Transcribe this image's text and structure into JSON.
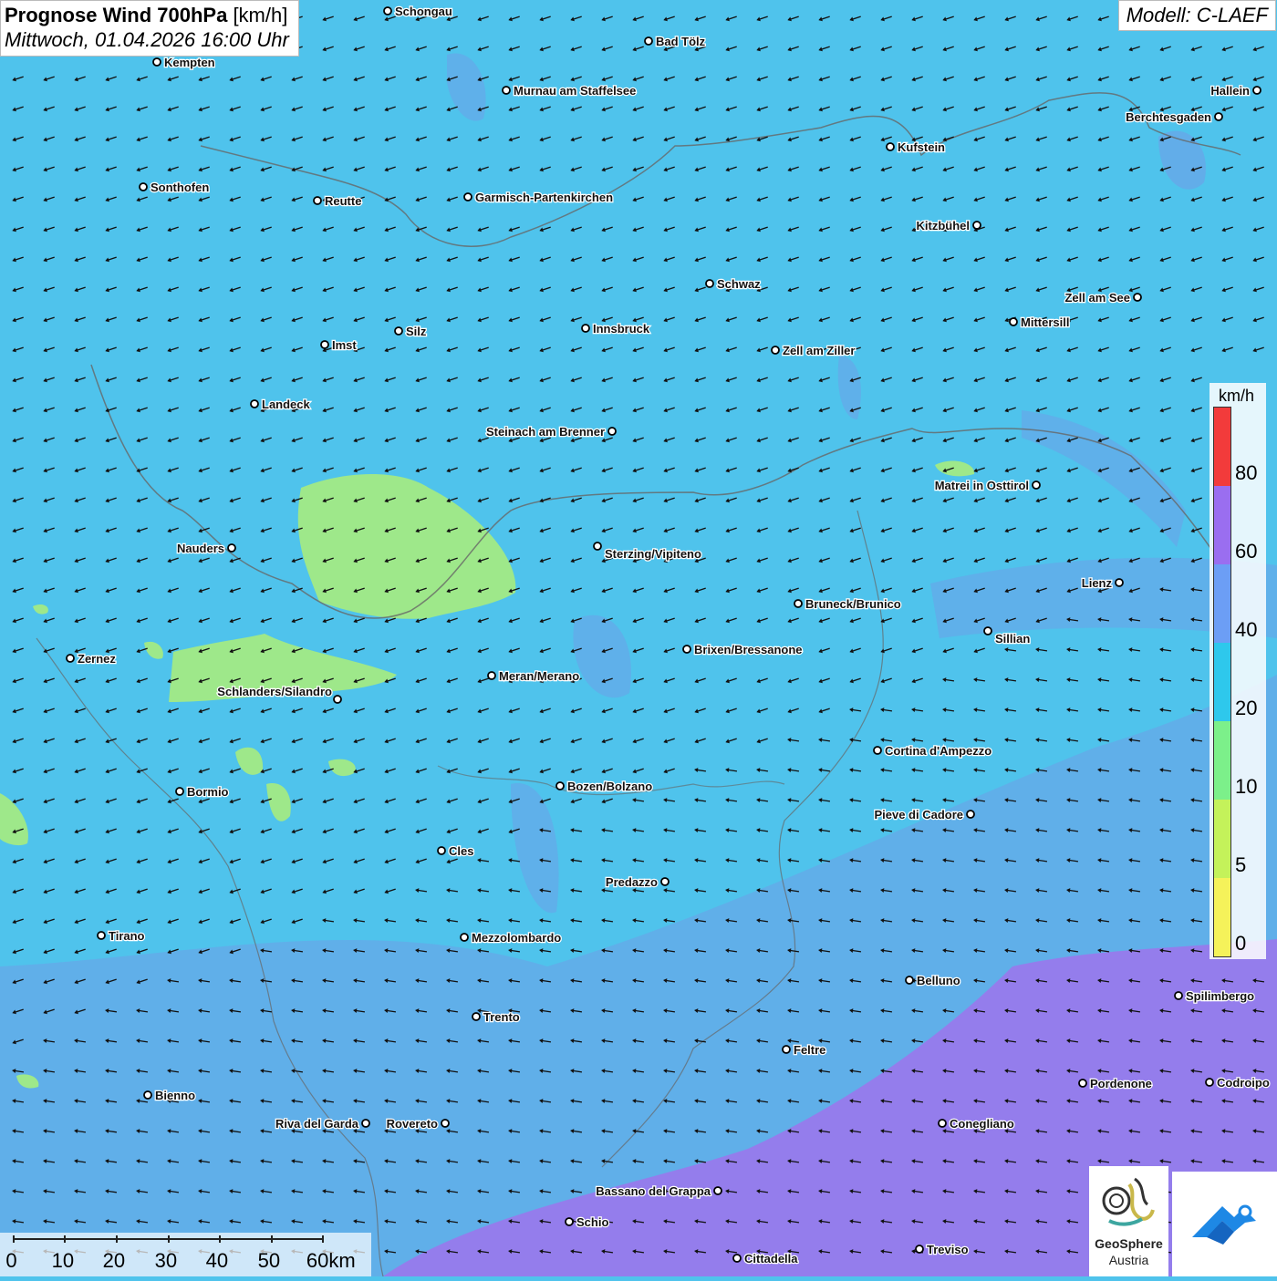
{
  "header": {
    "title": "Prognose Wind 700hPa",
    "title_unit": "[km/h]",
    "datetime": "Mittwoch, 01.04.2026 16:00 Uhr",
    "model": "Modell: C-LAEF"
  },
  "legend": {
    "unit": "km/h",
    "labels": [
      "80",
      "60",
      "40",
      "20",
      "10",
      "5",
      "0"
    ],
    "colors": [
      "#f23b3b",
      "#9a6ef0",
      "#6c9ef5",
      "#2ec8ec",
      "#7cf08a",
      "#c4f25a",
      "#f5f25a"
    ]
  },
  "scale": {
    "labels": [
      "0",
      "10",
      "20",
      "30",
      "40",
      "50",
      "60km"
    ]
  },
  "cities": [
    {
      "name": "Schongau"
    },
    {
      "name": "Bad Tölz"
    },
    {
      "name": "Kempten"
    },
    {
      "name": "Murnau am Staffelsee"
    },
    {
      "name": "Hallein"
    },
    {
      "name": "Berchtesgaden"
    },
    {
      "name": "Kufstein"
    },
    {
      "name": "Sonthofen"
    },
    {
      "name": "Reutte"
    },
    {
      "name": "Garmisch-Partenkirchen"
    },
    {
      "name": "Kitzbühel"
    },
    {
      "name": "Schwaz"
    },
    {
      "name": "Zell am See"
    },
    {
      "name": "Mittersill"
    },
    {
      "name": "Silz"
    },
    {
      "name": "Innsbruck"
    },
    {
      "name": "Imst"
    },
    {
      "name": "Zell am Ziller"
    },
    {
      "name": "Landeck"
    },
    {
      "name": "Steinach am Brenner"
    },
    {
      "name": "Matrei in Osttirol"
    },
    {
      "name": "Nauders"
    },
    {
      "name": "Sterzing/Vipiteno"
    },
    {
      "name": "Lienz"
    },
    {
      "name": "Bruneck/Brunico"
    },
    {
      "name": "Sillian"
    },
    {
      "name": "Zernez"
    },
    {
      "name": "Brixen/Bressanone"
    },
    {
      "name": "Meran/Merano"
    },
    {
      "name": "Schlanders/Silandro"
    },
    {
      "name": "Cortina d'Ampezzo"
    },
    {
      "name": "Bormio"
    },
    {
      "name": "Bozen/Bolzano"
    },
    {
      "name": "Pieve di Cadore"
    },
    {
      "name": "Cles"
    },
    {
      "name": "Predazzo"
    },
    {
      "name": "Tirano"
    },
    {
      "name": "Mezzolombardo"
    },
    {
      "name": "Belluno"
    },
    {
      "name": "Spilimbergo"
    },
    {
      "name": "Trento"
    },
    {
      "name": "Feltre"
    },
    {
      "name": "Pordenone"
    },
    {
      "name": "Codroipo"
    },
    {
      "name": "Bienno"
    },
    {
      "name": "Riva del Garda"
    },
    {
      "name": "Rovereto"
    },
    {
      "name": "Conegliano"
    },
    {
      "name": "Bassano del Grappa"
    },
    {
      "name": "Schio"
    },
    {
      "name": "Treviso"
    },
    {
      "name": "Cittadella"
    }
  ],
  "logo": {
    "brand": "GeoSphere",
    "sub": "Austria"
  }
}
